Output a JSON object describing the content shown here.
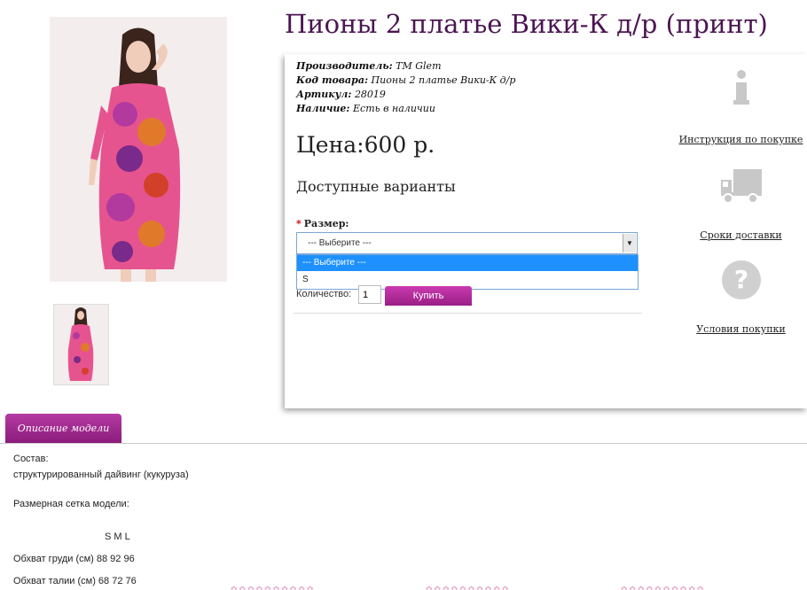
{
  "product": {
    "title": "Пионы 2 платье Вики-К д/р (принт)",
    "meta": {
      "manufacturer_label": "Производитель:",
      "manufacturer_value": "ТМ Glem",
      "code_label": "Код товара:",
      "code_value": "Пионы 2 платье Вики-К д/р",
      "article_label": "Артикул:",
      "article_value": "28019",
      "stock_label": "Наличие:",
      "stock_value": "Есть в наличии"
    },
    "price": "Цена:600 р.",
    "variants_heading": "Доступные варианты",
    "size": {
      "label": "Размер:",
      "required_mark": "*",
      "selected": "--- Выберите ---",
      "options": [
        "--- Выберите ---",
        "S"
      ]
    },
    "quantity_label": "Количество:",
    "quantity_value": "1",
    "buy_label": "Купить"
  },
  "side_links": [
    {
      "label": "Инструкция по покупке",
      "icon": "info-icon"
    },
    {
      "label": "Сроки доставки",
      "icon": "truck-icon"
    },
    {
      "label": "Условия покупки",
      "icon": "question-icon"
    }
  ],
  "tabs": {
    "description_tab": "Описание модели"
  },
  "description": {
    "composition_label": "Состав:",
    "composition_value": "структурированный дайвинг (кукуруза)",
    "size_chart_label": "Размерная сетка модели:",
    "size_header": "S  M  L",
    "chest_row": "Обхват груди (см) 88 92 96",
    "waist_row": "Обхват талии (см) 68 72 76"
  },
  "colors": {
    "title": "#4b1552",
    "accent": "#9a1f86",
    "select_highlight": "#1e90ff"
  }
}
